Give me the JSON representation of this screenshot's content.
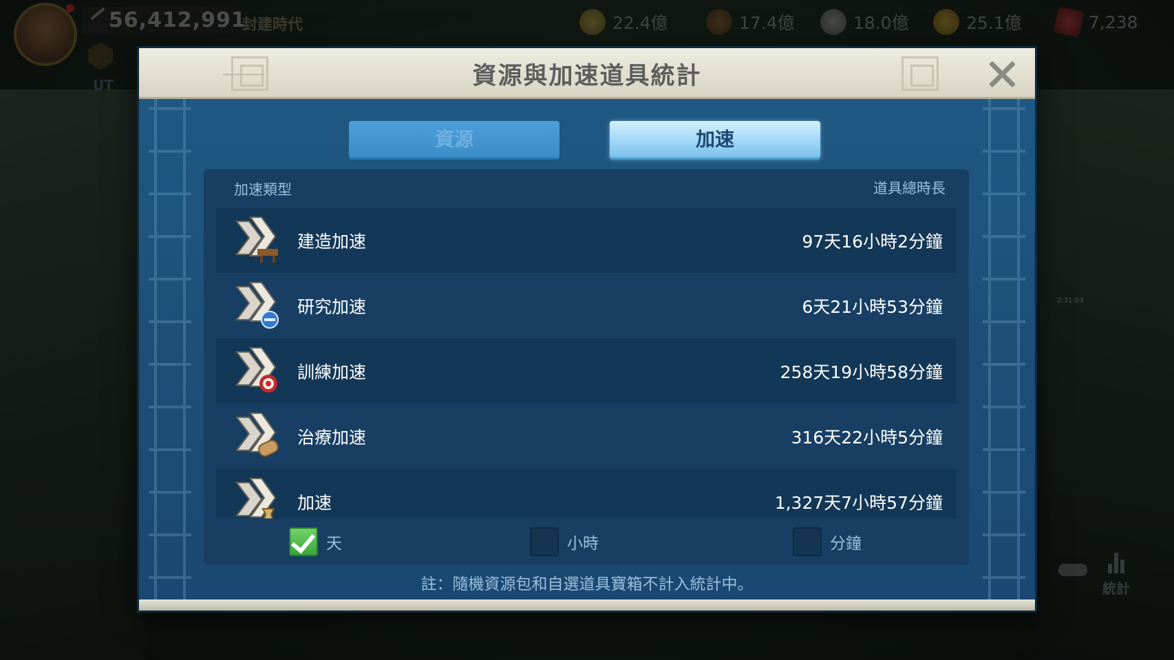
{
  "hud": {
    "power": "56,412,991",
    "era": "封建時代",
    "badge_text": "UT",
    "mini_tag": "",
    "resources": [
      {
        "icon": "food-icon",
        "value": "22.4億",
        "color": "#c9a43c"
      },
      {
        "icon": "wood-icon",
        "value": "17.4億",
        "color": "#8a5a2c"
      },
      {
        "icon": "stone-icon",
        "value": "18.0億",
        "color": "#9a9a9a"
      },
      {
        "icon": "gold-icon",
        "value": "25.1億",
        "color": "#d4a117"
      },
      {
        "icon": "gem-icon",
        "value": "7,238",
        "color": "#c0282b"
      }
    ],
    "stats_label": "統計",
    "side_tag": "",
    "side_time": "2:31:03"
  },
  "modal": {
    "title": "資源與加速道具統計",
    "tabs": {
      "resource": "資源",
      "speedup": "加速",
      "active": "speedup"
    },
    "header": {
      "type": "加速類型",
      "total": "道具總時長"
    },
    "rows": [
      {
        "name": "建造加速",
        "time": "97天16小時2分鐘",
        "icon": "build-speedup-icon"
      },
      {
        "name": "研究加速",
        "time": "6天21小時53分鐘",
        "icon": "research-speedup-icon"
      },
      {
        "name": "訓練加速",
        "time": "258天19小時58分鐘",
        "icon": "training-speedup-icon"
      },
      {
        "name": "治療加速",
        "time": "316天22小時5分鐘",
        "icon": "healing-speedup-icon"
      },
      {
        "name": "加速",
        "time": "1,327天7小時57分鐘",
        "icon": "universal-speedup-icon"
      }
    ],
    "units": [
      {
        "label": "天",
        "checked": true
      },
      {
        "label": "小時",
        "checked": false
      },
      {
        "label": "分鐘",
        "checked": false
      }
    ],
    "note": "註：隨機資源包和自選道具寶箱不計入統計中。"
  }
}
